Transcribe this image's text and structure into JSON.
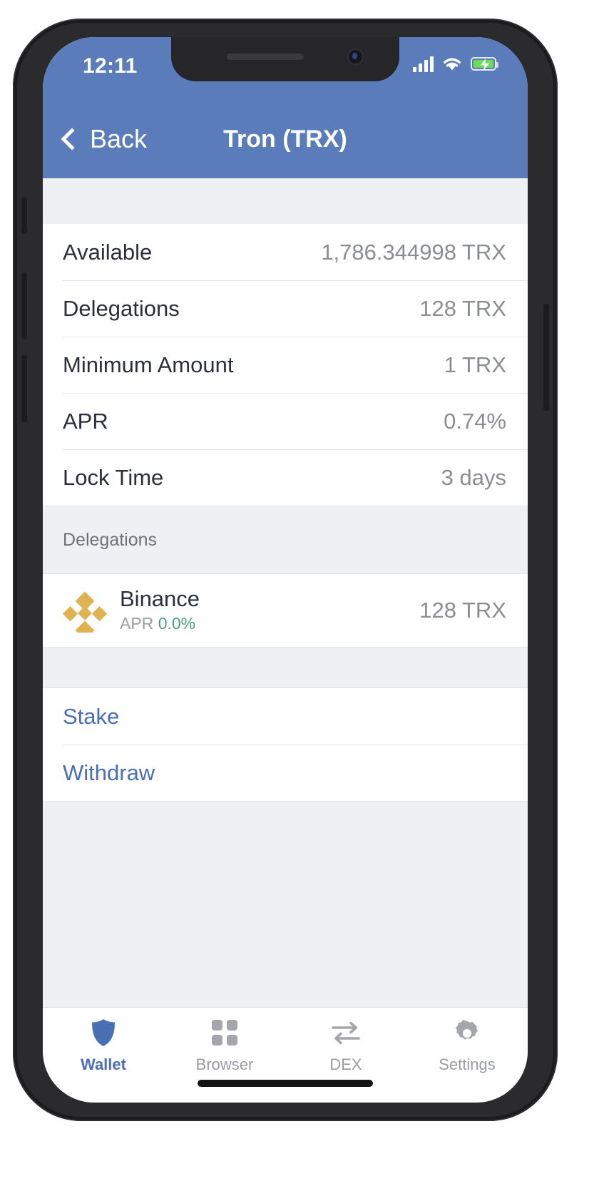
{
  "status_bar": {
    "time": "12:11",
    "signal_icon": "signal-bars-icon",
    "wifi_icon": "wifi-icon",
    "battery_icon": "battery-charging-icon",
    "battery_color": "#6ddc5a"
  },
  "nav": {
    "back_label": "Back",
    "back_icon": "chevron-left-icon",
    "title": "Tron (TRX)",
    "background_color": "#5a7cbb"
  },
  "info_rows": [
    {
      "label": "Available",
      "value": "1,786.344998 TRX"
    },
    {
      "label": "Delegations",
      "value": "128 TRX"
    },
    {
      "label": "Minimum Amount",
      "value": "1 TRX"
    },
    {
      "label": "APR",
      "value": "0.74%"
    },
    {
      "label": "Lock Time",
      "value": "3 days"
    }
  ],
  "delegations_section": {
    "header": "Delegations",
    "items": [
      {
        "name": "Binance",
        "apr_label": "APR",
        "apr_value": "0.0%",
        "amount": "128 TRX",
        "logo_icon": "binance-logo-icon",
        "logo_color": "#e0b352",
        "apr_color": "#4a9d7e"
      }
    ]
  },
  "actions": [
    {
      "label": "Stake",
      "name": "stake-button"
    },
    {
      "label": "Withdraw",
      "name": "withdraw-button"
    }
  ],
  "action_color": "#4a6fb5",
  "tabs": [
    {
      "label": "Wallet",
      "icon": "shield-icon",
      "active": true
    },
    {
      "label": "Browser",
      "icon": "grid-squares-icon",
      "active": false
    },
    {
      "label": "DEX",
      "icon": "swap-arrows-icon",
      "active": false
    },
    {
      "label": "Settings",
      "icon": "gear-icon",
      "active": false
    }
  ]
}
